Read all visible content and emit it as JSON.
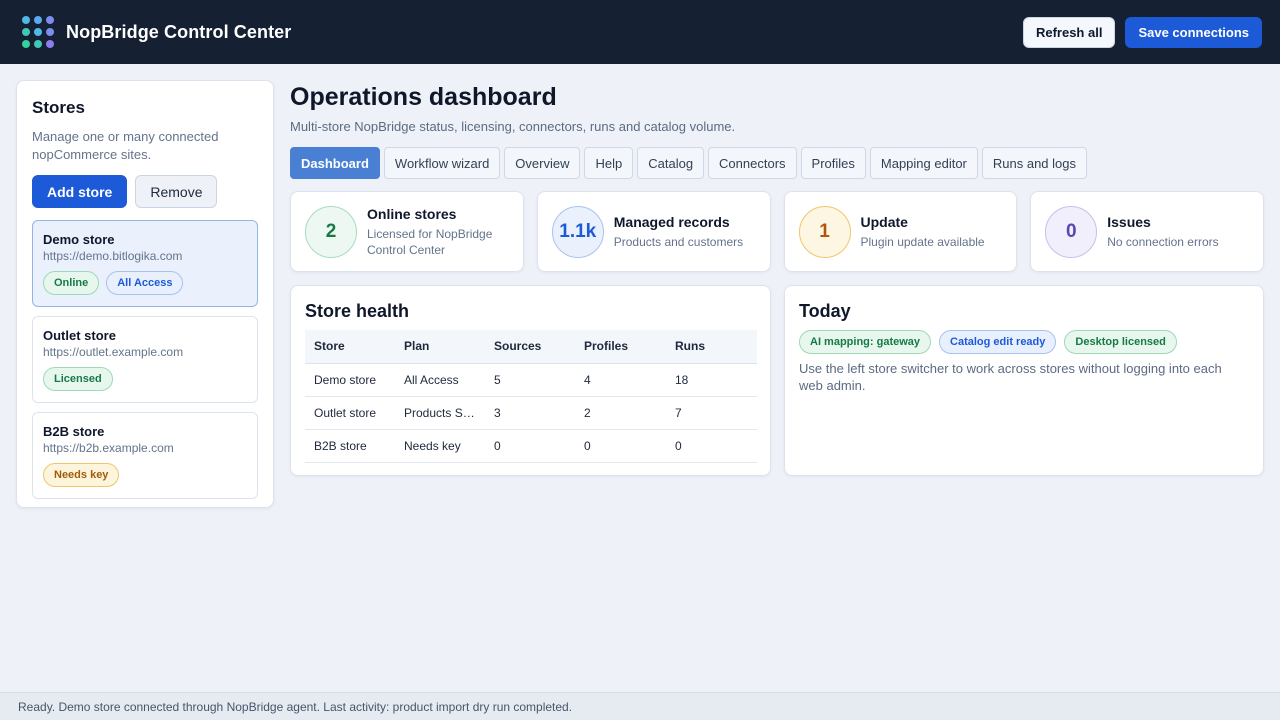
{
  "app": {
    "title": "NopBridge Control Center"
  },
  "header": {
    "refresh_label": "Refresh all",
    "save_label": "Save connections"
  },
  "sidebar": {
    "title": "Stores",
    "description": "Manage one or many connected nopCommerce sites.",
    "add_label": "Add store",
    "remove_label": "Remove",
    "stores": [
      {
        "name": "Demo store",
        "url": "https://demo.bitlogika.com",
        "badges": [
          "Online",
          "All Access"
        ],
        "selected": true
      },
      {
        "name": "Outlet store",
        "url": "https://outlet.example.com",
        "badges": [
          "Licensed"
        ]
      },
      {
        "name": "B2B store",
        "url": "https://b2b.example.com",
        "badges": [
          "Needs key"
        ]
      }
    ]
  },
  "main": {
    "title": "Operations dashboard",
    "subtitle": "Multi-store NopBridge status, licensing, connectors, runs and catalog volume.",
    "tabs": [
      "Dashboard",
      "Workflow wizard",
      "Overview",
      "Help",
      "Catalog",
      "Connectors",
      "Profiles",
      "Mapping editor",
      "Runs and logs"
    ],
    "active_tab": "Dashboard",
    "stats": [
      {
        "value": "2",
        "label": "Online stores",
        "sub": "Licensed for NopBridge Control Center"
      },
      {
        "value": "1.1k",
        "label": "Managed records",
        "sub": "Products and customers"
      },
      {
        "value": "1",
        "label": "Update",
        "sub": "Plugin update available"
      },
      {
        "value": "0",
        "label": "Issues",
        "sub": "No connection errors"
      }
    ],
    "health": {
      "title": "Store health",
      "columns": [
        "Store",
        "Plan",
        "Sources",
        "Profiles",
        "Runs"
      ],
      "rows": [
        [
          "Demo store",
          "All Access",
          "5",
          "4",
          "18"
        ],
        [
          "Outlet store",
          "Products Su...",
          "3",
          "2",
          "7"
        ],
        [
          "B2B store",
          "Needs key",
          "0",
          "0",
          "0"
        ]
      ]
    },
    "today": {
      "title": "Today",
      "badges": [
        "AI mapping: gateway",
        "Catalog edit ready",
        "Desktop licensed"
      ],
      "text": "Use the left store switcher to work across stores without logging into each web admin."
    }
  },
  "status": {
    "text": "Ready. Demo store connected through NopBridge agent. Last activity: product import dry run completed."
  },
  "colors": {
    "header_bg": "#162033",
    "primary": "#1d5ad8",
    "active_tab": "#4a80d4",
    "page_bg": "#eef2f8"
  },
  "icons": {
    "logo": "dot-grid-logo-icon"
  }
}
